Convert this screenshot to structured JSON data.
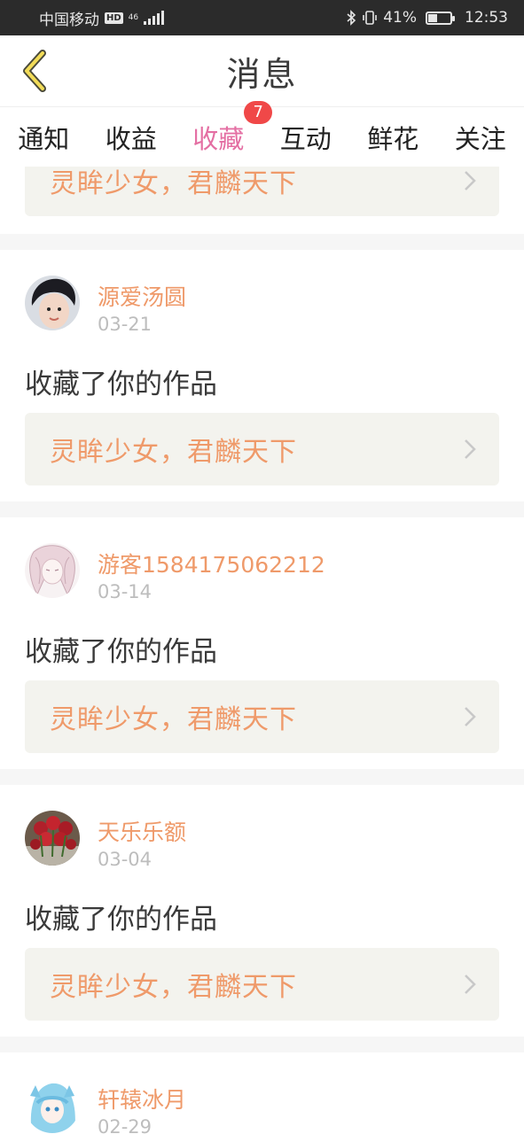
{
  "status_bar": {
    "carrier": "中国移动",
    "hd": "HD",
    "network": "46",
    "battery_percent": "41%",
    "battery_level": 0.41,
    "time": "12:53"
  },
  "header": {
    "title": "消息"
  },
  "tabs": [
    {
      "label": "通知",
      "active": false
    },
    {
      "label": "收益",
      "active": false
    },
    {
      "label": "收藏",
      "active": true,
      "badge": "7"
    },
    {
      "label": "互动",
      "active": false
    },
    {
      "label": "鲜花",
      "active": false
    },
    {
      "label": "关注",
      "active": false
    }
  ],
  "feed": {
    "partial_top_card": {
      "work_title": "灵眸少女，君麟天下"
    },
    "items": [
      {
        "username": "源爱汤圆",
        "date": "03-21",
        "action": "收藏了你的作品",
        "work_title": "灵眸少女，君麟天下",
        "avatar": "boy-portrait"
      },
      {
        "username": "游客1584175062212",
        "date": "03-14",
        "action": "收藏了你的作品",
        "work_title": "灵眸少女，君麟天下",
        "avatar": "anime-sketch"
      },
      {
        "username": "天乐乐额",
        "date": "03-04",
        "action": "收藏了你的作品",
        "work_title": "灵眸少女，君麟天下",
        "avatar": "red-roses"
      },
      {
        "username": "轩辕冰月",
        "date": "02-29",
        "avatar": "blue-hair-anime"
      }
    ]
  },
  "colors": {
    "accent_pink": "#e46fa3",
    "name_orange": "#ef9a6a",
    "badge_red": "#f04848",
    "status_bar": "#2b2b2b",
    "link_bg": "#f3f3ee"
  }
}
